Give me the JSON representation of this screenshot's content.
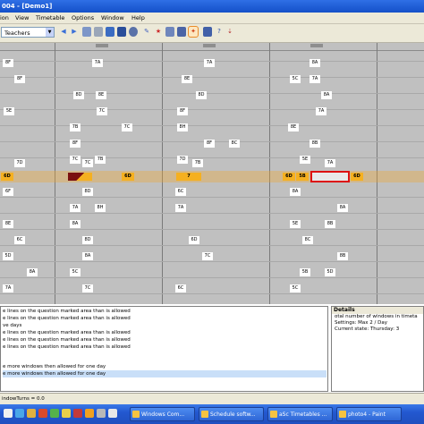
{
  "window": {
    "title": "004 - [Demo1]"
  },
  "menubar": [
    "ion",
    "View",
    "Timetable",
    "Options",
    "Window",
    "Help"
  ],
  "toolbar": {
    "view_select": "Teachers"
  },
  "grid": {
    "cells": [
      {
        "t": "8F",
        "c": "w"
      },
      {
        "t": "7A",
        "c": "w"
      },
      {
        "t": "7A",
        "c": "w"
      },
      {
        "t": "8A",
        "c": "w"
      },
      {
        "t": "8F",
        "c": "w"
      },
      {
        "t": "8E",
        "c": "w"
      },
      {
        "t": "5C",
        "c": "w"
      },
      {
        "t": "7A",
        "c": "w"
      },
      {
        "t": "8D",
        "c": "w"
      },
      {
        "t": "8E",
        "c": "w"
      },
      {
        "t": "8D",
        "c": "w"
      },
      {
        "t": "8A",
        "c": "w"
      },
      {
        "t": "7C",
        "c": "w"
      },
      {
        "t": "5E",
        "c": "w"
      },
      {
        "t": "8F",
        "c": "w"
      },
      {
        "t": "7A",
        "c": "w"
      },
      {
        "t": "7B",
        "c": "w"
      },
      {
        "t": "7C",
        "c": "w"
      },
      {
        "t": "8H",
        "c": "w"
      },
      {
        "t": "8E",
        "c": "w"
      },
      {
        "t": "8F",
        "c": "w"
      },
      {
        "t": "8C",
        "c": "w"
      },
      {
        "t": "8F",
        "c": "w"
      },
      {
        "t": "8B",
        "c": "w"
      },
      {
        "t": "7C",
        "c": "w"
      },
      {
        "t": "7B",
        "c": "w"
      },
      {
        "t": "7D",
        "c": "w"
      },
      {
        "t": "5E",
        "c": "w"
      },
      {
        "t": "7D",
        "c": "w"
      },
      {
        "t": "7C",
        "c": "w"
      },
      {
        "t": "7B",
        "c": "w"
      },
      {
        "t": "7A",
        "c": "w"
      },
      {
        "t": "6D",
        "c": "y"
      },
      {
        "t": "",
        "c": "d"
      },
      {
        "t": "6D",
        "c": "y"
      },
      {
        "t": "7",
        "c": "y"
      },
      {
        "t": "6D",
        "c": "y"
      },
      {
        "t": "5B",
        "c": "y"
      },
      {
        "t": "",
        "c": "r"
      },
      {
        "t": "6D",
        "c": "y"
      },
      {
        "t": "6F",
        "c": "w"
      },
      {
        "t": "8D",
        "c": "w"
      },
      {
        "t": "6C",
        "c": "w"
      },
      {
        "t": "8A",
        "c": "w"
      },
      {
        "t": "7A",
        "c": "w"
      },
      {
        "t": "8H",
        "c": "w"
      },
      {
        "t": "7A",
        "c": "w"
      },
      {
        "t": "8A",
        "c": "w"
      },
      {
        "t": "8E",
        "c": "w"
      },
      {
        "t": "8A",
        "c": "w"
      },
      {
        "t": "5E",
        "c": "w"
      },
      {
        "t": "8B",
        "c": "w"
      },
      {
        "t": "6C",
        "c": "w"
      },
      {
        "t": "8D",
        "c": "w"
      },
      {
        "t": "6D",
        "c": "w"
      },
      {
        "t": "8C",
        "c": "w"
      },
      {
        "t": "5D",
        "c": "w"
      },
      {
        "t": "8A",
        "c": "w"
      },
      {
        "t": "7C",
        "c": "w"
      },
      {
        "t": "8B",
        "c": "w"
      },
      {
        "t": "8A",
        "c": "w"
      },
      {
        "t": "5C",
        "c": "w"
      },
      {
        "t": "5B",
        "c": "w"
      },
      {
        "t": "5D",
        "c": "w"
      },
      {
        "t": "7A",
        "c": "w"
      },
      {
        "t": "7C",
        "c": "w"
      },
      {
        "t": "6C",
        "c": "w"
      },
      {
        "t": "5C",
        "c": "w"
      }
    ]
  },
  "messages": [
    "e lines on the question marked area than is allowed",
    "e lines on the question marked area than is allowed",
    "ve days",
    "e lines on the question marked area than is allowed",
    "e lines on the question marked area than is allowed",
    "e lines on the question marked area than is allowed",
    "e more windows then allowed for one day",
    "e more windows then allowed for one day"
  ],
  "details": {
    "header": "Details",
    "lines": [
      "otal number of windows in timeta",
      "Settings: Max 2 / Day",
      "Current state: Thursday: 3"
    ]
  },
  "statusbar": {
    "text": "indowTurns = 0.0"
  },
  "taskbar": {
    "buttons": [
      "Windows Com...",
      "Schedule softw...",
      "aSc Timetables ...",
      "photo4 - Paint"
    ]
  },
  "colors": {
    "title_bar": "#1450c8",
    "grid_bg": "#c0c0c0",
    "highlight_yellow": "#f5b020",
    "conflict_red": "#d11111",
    "taskbar": "#2358d0"
  }
}
